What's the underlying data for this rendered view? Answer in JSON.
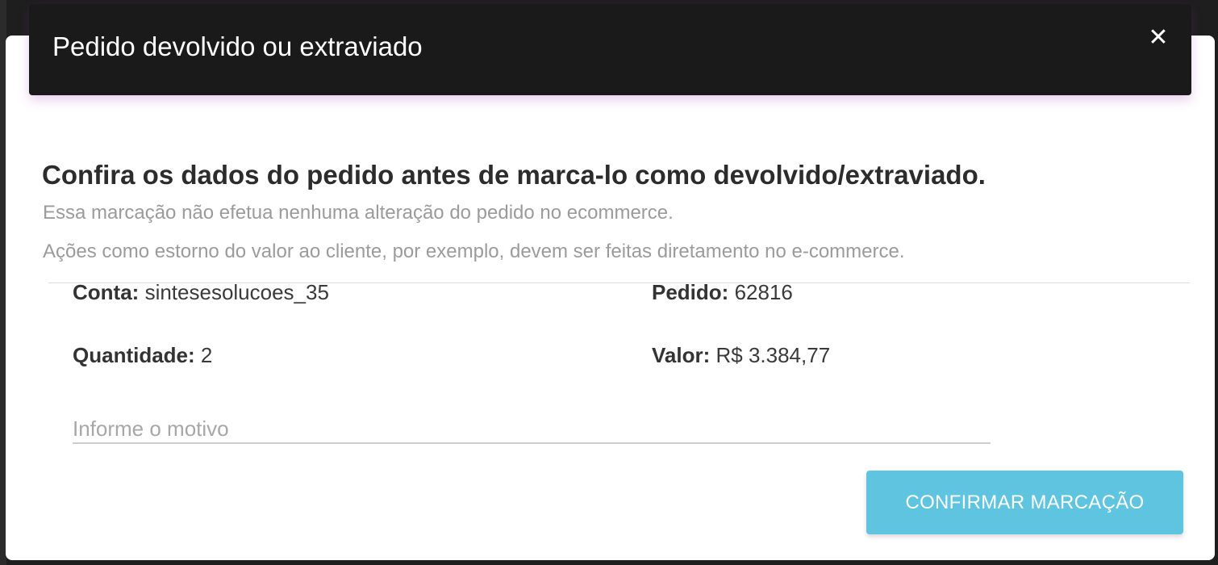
{
  "dialog": {
    "title": "Pedido devolvido ou extraviado",
    "close_icon": "close-icon",
    "close_glyph": "✕"
  },
  "content": {
    "heading": "Confira os dados do pedido antes de marca-lo como devolvido/extraviado.",
    "notes": [
      "Essa marcação não efetua nenhuma alteração do pedido no ecommerce.",
      "Ações como estorno do valor ao cliente, por exemplo, devem ser feitas diretamento no e-commerce."
    ]
  },
  "fields": {
    "conta": {
      "label": "Conta:",
      "value": "sintesesolucoes_35"
    },
    "pedido": {
      "label": "Pedido:",
      "value": "62816"
    },
    "quantidade": {
      "label": "Quantidade:",
      "value": "2"
    },
    "valor": {
      "label": "Valor:",
      "value": "R$ 3.384,77"
    }
  },
  "reason": {
    "placeholder": "Informe o motivo",
    "value": ""
  },
  "actions": {
    "confirm_label": "CONFIRMAR MARCAÇÃO"
  },
  "colors": {
    "header_bg": "#1a1a1a",
    "button_bg": "#5ec4e0",
    "muted_text": "#9b9b9b"
  }
}
